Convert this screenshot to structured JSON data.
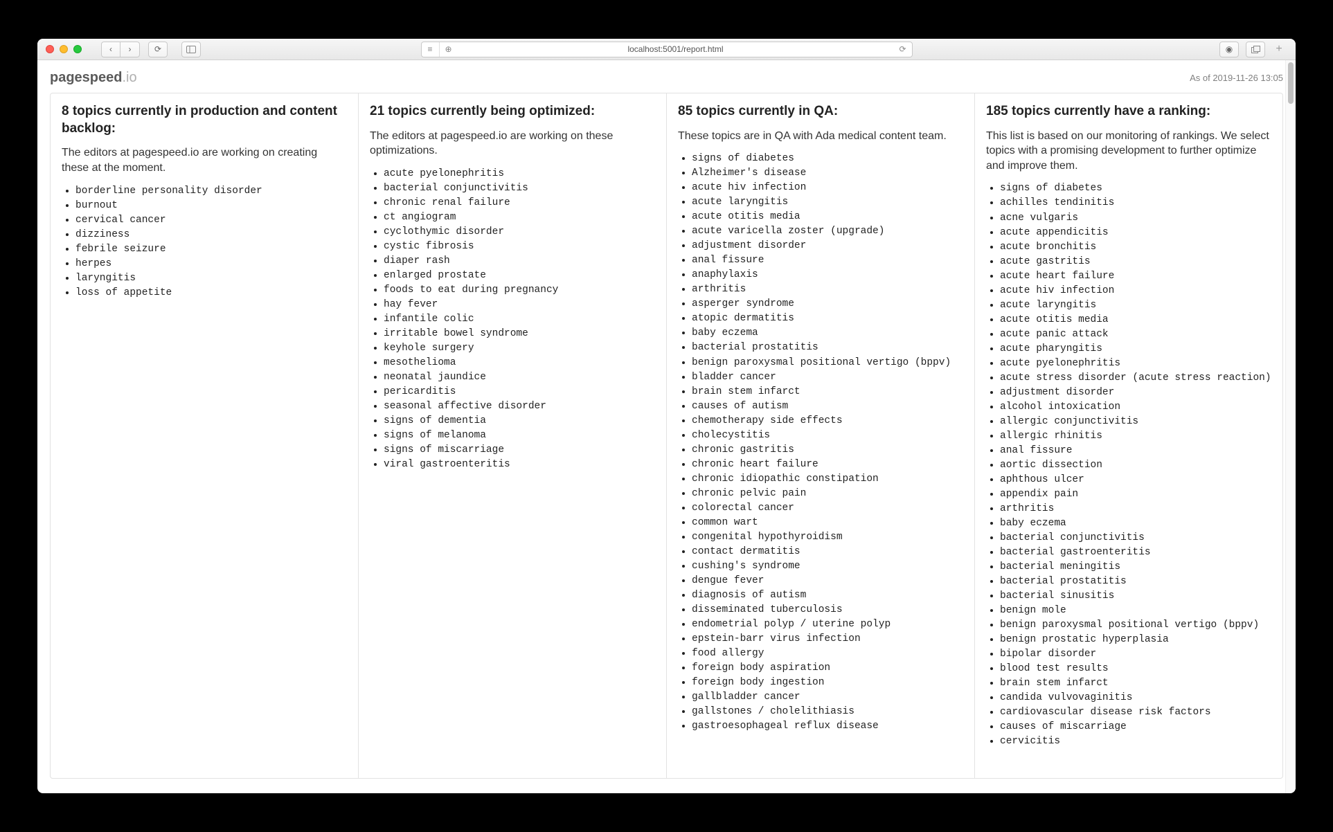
{
  "browser": {
    "url": "localhost:5001/report.html"
  },
  "header": {
    "logo_main": "pagespeed",
    "logo_suffix": ".io",
    "timestamp": "As of 2019-11-26 13:05"
  },
  "columns": [
    {
      "title": "8 topics currently in production and content backlog:",
      "description": "The editors at pagespeed.io are working on creating these at the moment.",
      "items": [
        "borderline personality disorder",
        "burnout",
        "cervical cancer",
        "dizziness",
        "febrile seizure",
        "herpes",
        "laryngitis",
        "loss of appetite"
      ]
    },
    {
      "title": "21 topics currently being optimized:",
      "description": "The editors at pagespeed.io are working on these optimizations.",
      "items": [
        "acute pyelonephritis",
        "bacterial conjunctivitis",
        "chronic renal failure",
        "ct angiogram",
        "cyclothymic disorder",
        "cystic fibrosis",
        "diaper rash",
        "enlarged prostate",
        "foods to eat during pregnancy",
        "hay fever",
        "infantile colic",
        "irritable bowel syndrome",
        "keyhole surgery",
        "mesothelioma",
        "neonatal jaundice",
        "pericarditis",
        "seasonal affective disorder",
        "signs of dementia",
        "signs of melanoma",
        "signs of miscarriage",
        "viral gastroenteritis"
      ]
    },
    {
      "title": "85 topics currently in QA:",
      "description": "These topics are in QA with Ada medical content team.",
      "items": [
        "signs of diabetes",
        "Alzheimer's disease",
        "acute hiv infection",
        "acute laryngitis",
        "acute otitis media",
        "acute varicella zoster (upgrade)",
        "adjustment disorder",
        "anal fissure",
        "anaphylaxis",
        "arthritis",
        "asperger syndrome",
        "atopic dermatitis",
        "baby eczema",
        "bacterial prostatitis",
        "benign paroxysmal positional vertigo (bppv)",
        "bladder cancer",
        "brain stem infarct",
        "causes of autism",
        "chemotherapy side effects",
        "cholecystitis",
        "chronic gastritis",
        "chronic heart failure",
        "chronic idiopathic constipation",
        "chronic pelvic pain",
        "colorectal cancer",
        "common wart",
        "congenital hypothyroidism",
        "contact dermatitis",
        "cushing's syndrome",
        "dengue fever",
        "diagnosis of autism",
        "disseminated tuberculosis",
        "endometrial polyp / uterine polyp",
        "epstein-barr virus infection",
        "food allergy",
        "foreign body aspiration",
        "foreign body ingestion",
        "gallbladder cancer",
        "gallstones / cholelithiasis",
        "gastroesophageal reflux disease"
      ]
    },
    {
      "title": "185 topics currently have a ranking:",
      "description": "This list is based on our monitoring of rankings. We select topics with a promising development to further optimize and improve them.",
      "items": [
        "signs of diabetes",
        "achilles tendinitis",
        "acne vulgaris",
        "acute appendicitis",
        "acute bronchitis",
        "acute gastritis",
        "acute heart failure",
        "acute hiv infection",
        "acute laryngitis",
        "acute otitis media",
        "acute panic attack",
        "acute pharyngitis",
        "acute pyelonephritis",
        "acute stress disorder (acute stress reaction)",
        "adjustment disorder",
        "alcohol intoxication",
        "allergic conjunctivitis",
        "allergic rhinitis",
        "anal fissure",
        "aortic dissection",
        "aphthous ulcer",
        "appendix pain",
        "arthritis",
        "baby eczema",
        "bacterial conjunctivitis",
        "bacterial gastroenteritis",
        "bacterial meningitis",
        "bacterial prostatitis",
        "bacterial sinusitis",
        "benign mole",
        "benign paroxysmal positional vertigo (bppv)",
        "benign prostatic hyperplasia",
        "bipolar disorder",
        "blood test results",
        "brain stem infarct",
        "candida vulvovaginitis",
        "cardiovascular disease risk factors",
        "causes of miscarriage",
        "cervicitis"
      ]
    }
  ]
}
